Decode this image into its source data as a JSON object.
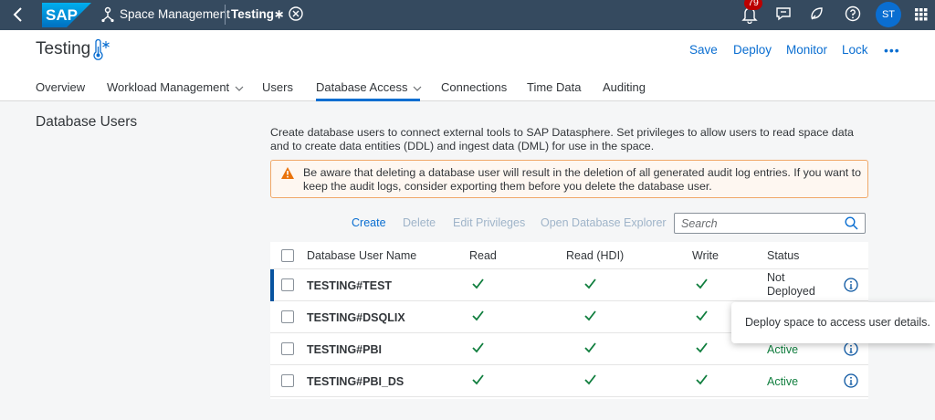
{
  "shell": {
    "logo_text": "SAP",
    "app_title": "Space Management",
    "breadcrumb": "Testing∗",
    "notification_count": "79",
    "avatar_initials": "ST"
  },
  "header": {
    "title": "Testing",
    "actions": {
      "save": "Save",
      "deploy": "Deploy",
      "monitor": "Monitor",
      "lock": "Lock",
      "more": "•••"
    },
    "tabs": [
      {
        "label": "Overview"
      },
      {
        "label": "Workload Management"
      },
      {
        "label": "Users"
      },
      {
        "label": "Database Access"
      },
      {
        "label": "Connections"
      },
      {
        "label": "Time Data"
      },
      {
        "label": "Auditing"
      }
    ]
  },
  "content": {
    "section_title": "Database Users",
    "description": "Create database users to connect external tools to SAP Datasphere. Set privileges to allow users to read space data and to create data entities (DDL) and ingest data (DML) for use in the space.",
    "warning": "Be aware that deleting a database user will result in the deletion of all generated audit log entries. If you want to keep the audit logs, consider exporting them before you delete the database user.",
    "toolbar": {
      "create": "Create",
      "delete": "Delete",
      "edit_privileges": "Edit Privileges",
      "open_explorer": "Open Database Explorer",
      "search_placeholder": "Search"
    },
    "table": {
      "columns": {
        "name": "Database User Name",
        "read": "Read",
        "read_hdi": "Read (HDI)",
        "write": "Write",
        "status": "Status"
      },
      "rows": [
        {
          "name": "TESTING#TEST",
          "read": true,
          "read_hdi": true,
          "write": true,
          "status": "Not Deployed"
        },
        {
          "name": "TESTING#DSQLIX",
          "read": true,
          "read_hdi": true,
          "write": true,
          "status": ""
        },
        {
          "name": "TESTING#PBI",
          "read": true,
          "read_hdi": true,
          "write": true,
          "status": "Active"
        },
        {
          "name": "TESTING#PBI_DS",
          "read": true,
          "read_hdi": true,
          "write": true,
          "status": "Active"
        }
      ]
    },
    "popover": "Deploy space to access user details."
  },
  "colors": {
    "shell": "#354a5f",
    "accent": "#0a6ed1",
    "success": "#107e3e",
    "warning_border": "#f0a868"
  }
}
